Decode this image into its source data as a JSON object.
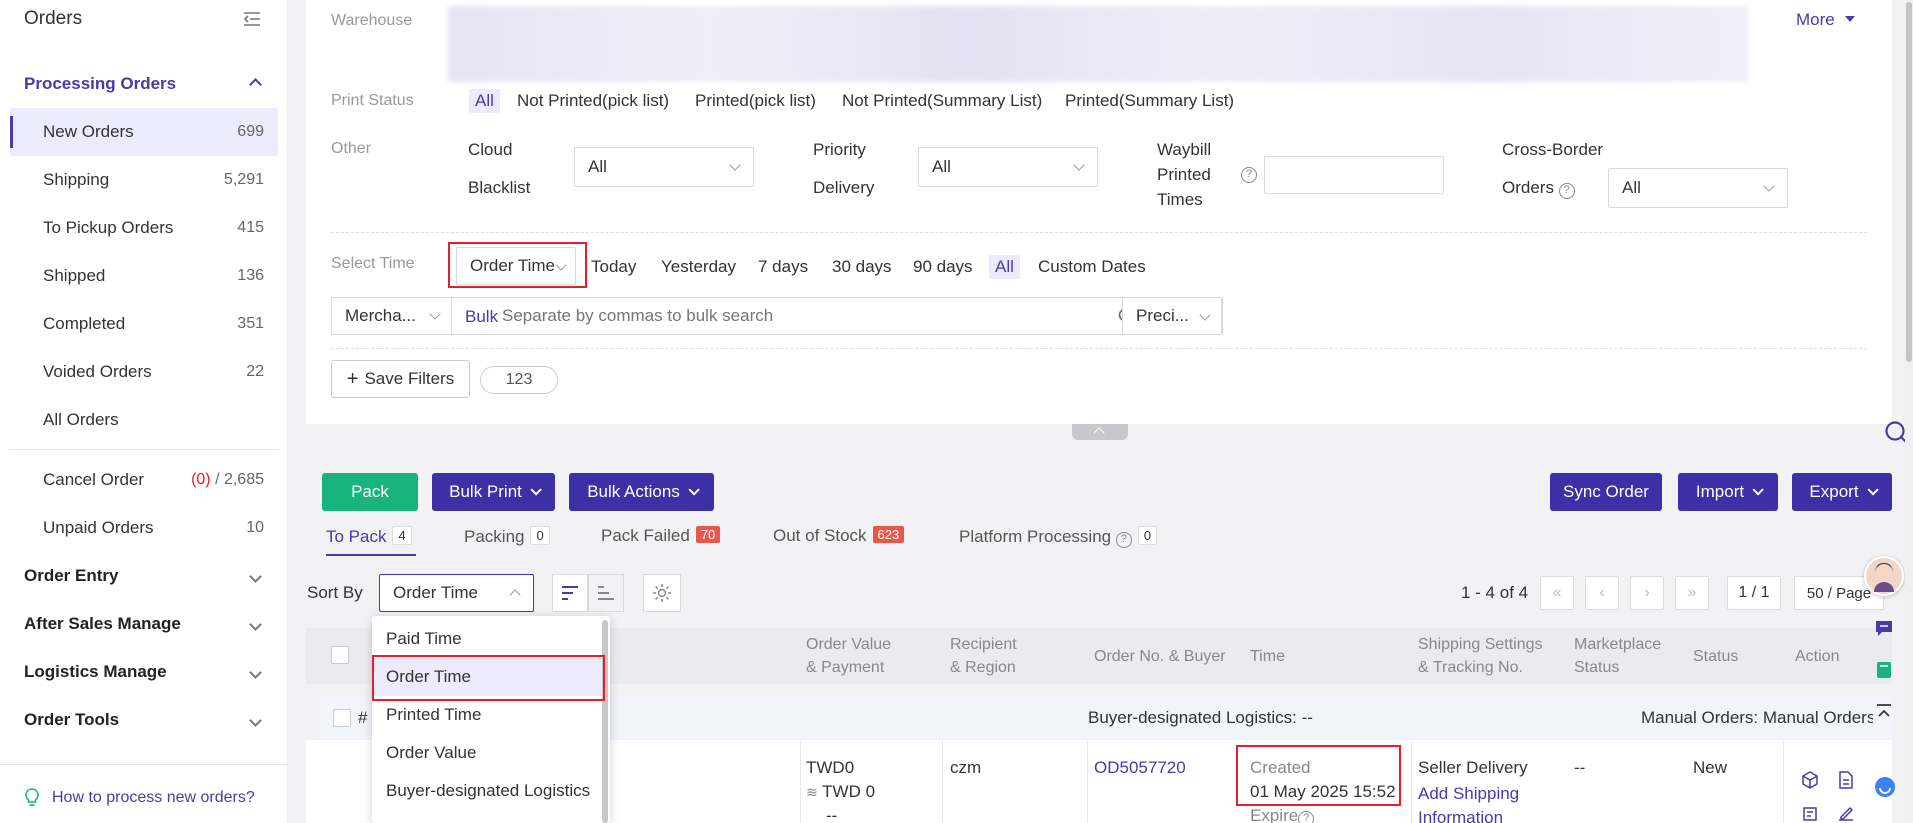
{
  "sidebar": {
    "title": "Orders",
    "processing": "Processing Orders",
    "items": [
      {
        "label": "New Orders",
        "count": "699"
      },
      {
        "label": "Shipping",
        "count": "5,291"
      },
      {
        "label": "To Pickup Orders",
        "count": "415"
      },
      {
        "label": "Shipped",
        "count": "136"
      },
      {
        "label": "Completed",
        "count": "351"
      },
      {
        "label": "Voided Orders",
        "count": "22"
      },
      {
        "label": "All Orders",
        "count": ""
      }
    ],
    "cancel_order": {
      "label": "Cancel Order",
      "count_red": "(0)",
      "count_rest": " / 2,685"
    },
    "unpaid_orders": {
      "label": "Unpaid Orders",
      "count": "10"
    },
    "groups": [
      "Order Entry",
      "After Sales Manage",
      "Logistics Manage",
      "Order Tools"
    ],
    "help_link": "How to process new orders?"
  },
  "filters": {
    "warehouse_label": "Warehouse",
    "more": "More",
    "print_status_label": "Print Status",
    "print_status_options": [
      "All",
      "Not Printed(pick list)",
      "Printed(pick list)",
      "Not Printed(Summary List)",
      "Printed(Summary List)"
    ],
    "other_label": "Other",
    "cloud_blacklist_1": "Cloud",
    "cloud_blacklist_2": "Blacklist",
    "cloud_blacklist_value": "All",
    "priority_delivery_1": "Priority",
    "priority_delivery_2": "Delivery",
    "priority_delivery_value": "All",
    "waybill_1": "Waybill",
    "waybill_2": "Printed",
    "waybill_3": "Times",
    "cross_border_1": "Cross-Border",
    "cross_border_2": "Orders",
    "cross_border_value": "All",
    "select_time_label": "Select Time",
    "time_type": "Order Time",
    "time_options": [
      "Today",
      "Yesterday",
      "7 days",
      "30 days",
      "90 days",
      "All",
      "Custom Dates"
    ],
    "search_field": "Mercha...",
    "bulk": "Bulk",
    "search_placeholder": "Separate by commas to bulk search",
    "precision": "Preci...",
    "save_filters": "Save Filters",
    "saved_tag": "123"
  },
  "toolbar": {
    "pack": "Pack",
    "bulk_print": "Bulk Print",
    "bulk_actions": "Bulk Actions",
    "sync_order": "Sync Order",
    "import": "Import",
    "export": "Export"
  },
  "tabs": [
    {
      "label": "To Pack",
      "count": "4"
    },
    {
      "label": "Packing",
      "count": "0"
    },
    {
      "label": "Pack Failed",
      "count": "70"
    },
    {
      "label": "Out of Stock",
      "count": "623"
    },
    {
      "label": "Platform Processing",
      "count": "0"
    }
  ],
  "sort": {
    "label": "Sort By",
    "value": "Order Time",
    "options": [
      "Paid Time",
      "Order Time",
      "Printed Time",
      "Order Value",
      "Buyer-designated Logistics"
    ]
  },
  "pager": {
    "range": "1 - 4 of 4",
    "page": "1 / 1",
    "per_page": "50 / Page"
  },
  "table": {
    "headers": {
      "order_value_1": "Order Value",
      "order_value_2": "& Payment",
      "recipient_1": "Recipient",
      "recipient_2": "& Region",
      "order_no": "Order No. & Buyer",
      "time": "Time",
      "shipping_1": "Shipping Settings",
      "shipping_2": "& Tracking No.",
      "marketplace_1": "Marketplace",
      "marketplace_2": "Status",
      "status": "Status",
      "action": "Action"
    },
    "group_row": {
      "hash": "#",
      "logistics": "Buyer-designated Logistics: --",
      "manual": "Manual Orders: Manual Orders"
    },
    "row": {
      "value": "TWD0",
      "payment": "TWD 0",
      "payment_extra": "--",
      "recipient": "czm",
      "order_no": "OD5057720",
      "created_label": "Created",
      "created_time": "01 May 2025 15:52",
      "expire": "Expire",
      "shipping": "Seller Delivery",
      "add_shipping_1": "Add Shipping",
      "add_shipping_2": "Information",
      "marketplace": "--",
      "status": "New"
    }
  },
  "colors": {
    "accent": "#4a3aa8",
    "pack_green": "#19b37e",
    "red": "#e0202a"
  }
}
